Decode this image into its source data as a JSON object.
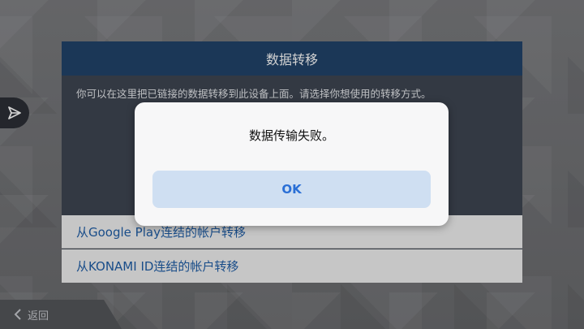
{
  "panel": {
    "title": "数据转移",
    "description": "你可以在这里把已链接的数据转移到此设备上面。请选择你想使用的转移方式。",
    "options": [
      {
        "label": "从Google Play连结的帐户转移"
      },
      {
        "label": "从KONAMI ID连结的帐户转移"
      }
    ]
  },
  "back": {
    "label": "返回",
    "icon": "chevron-left-icon"
  },
  "side_button": {
    "icon": "paper-plane-icon"
  },
  "dialog": {
    "message": "数据传输失败。",
    "ok_label": "OK"
  },
  "colors": {
    "header": "#22446b",
    "panel": "#3f4652",
    "option_text": "#1f5ea8",
    "ok_button_bg": "#cfdff2",
    "ok_button_text": "#2a6fd6"
  }
}
